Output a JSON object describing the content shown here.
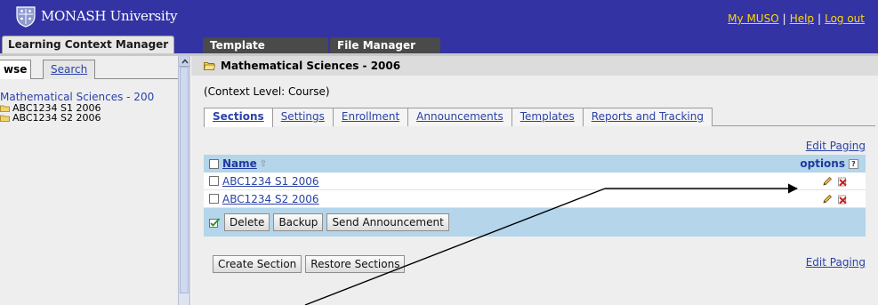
{
  "header": {
    "logo_text": "MONASH University",
    "links": [
      "My MUSO",
      "Help",
      "Log out"
    ],
    "separator": "|"
  },
  "app_tabs": {
    "active": "Learning Context Manager",
    "others": [
      "Template Manager",
      "File Manager"
    ]
  },
  "sidebar": {
    "tab_browse": "wse",
    "tab_search": "Search",
    "tree_root": "Mathematical Sciences - 200",
    "tree_items": [
      "ABC1234 S1 2006",
      "ABC1234 S2 2006"
    ]
  },
  "main": {
    "title": "Mathematical Sciences - 2006",
    "context_level": "(Context Level: Course)",
    "subtabs": [
      "Sections",
      "Settings",
      "Enrollment",
      "Announcements",
      "Templates",
      "Reports and Tracking"
    ],
    "active_subtab": "Sections",
    "edit_paging": "Edit Paging",
    "grid": {
      "col_name": "Name",
      "col_options": "options",
      "help_mark": "?",
      "rows": [
        "ABC1234 S1 2006",
        "ABC1234 S2 2006"
      ]
    },
    "actions": {
      "delete": "Delete",
      "backup": "Backup",
      "send": "Send Announcement"
    },
    "bottom": {
      "create": "Create Section",
      "restore": "Restore Sections"
    }
  },
  "colors": {
    "header_bg": "#3333a4",
    "grid_header_bg": "#b4d5ea",
    "link": "#2b42a8",
    "top_link": "#ffd700"
  }
}
